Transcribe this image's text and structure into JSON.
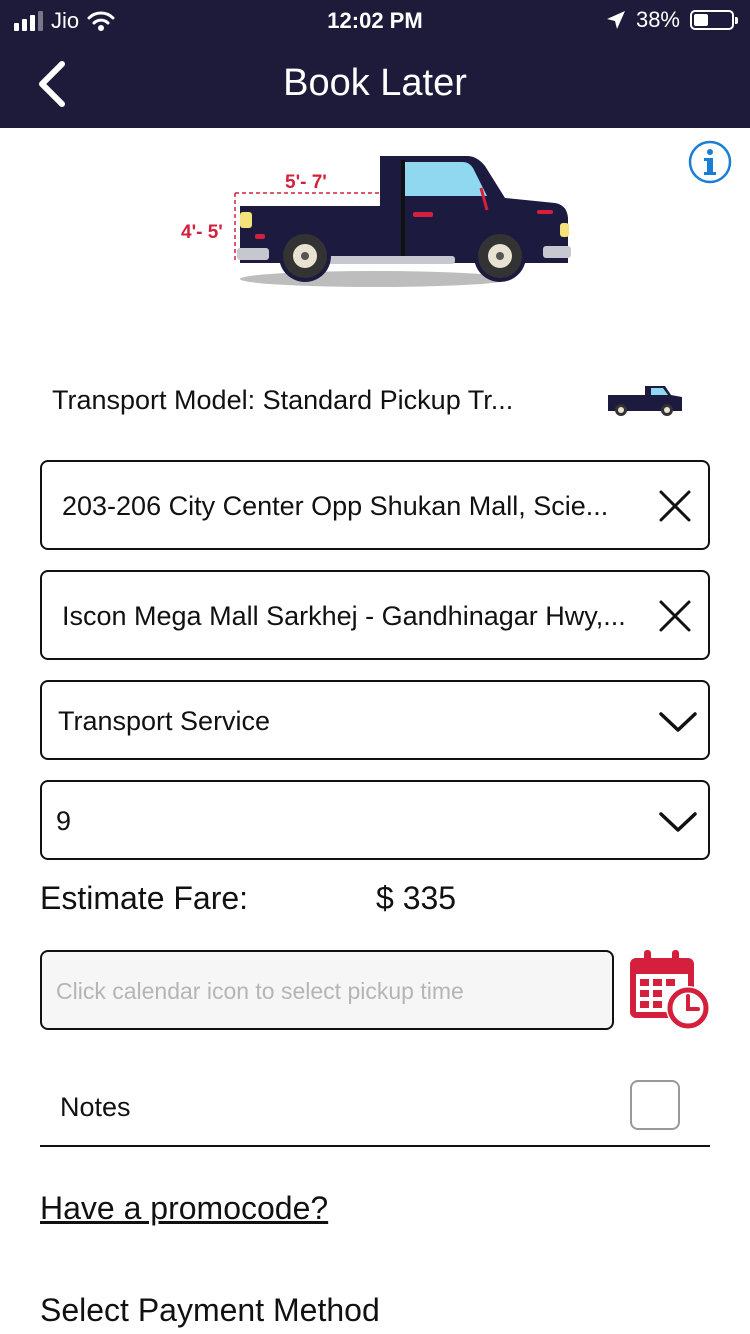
{
  "status_bar": {
    "carrier": "Jio",
    "time": "12:02 PM",
    "battery": "38%",
    "battery_level": 0.38
  },
  "header": {
    "title": "Book Later"
  },
  "transport_model": {
    "label": "Transport Model: Standard Pickup Tr..."
  },
  "truck_dimensions": {
    "length": "5'- 7'",
    "height": "4'- 5'"
  },
  "pickup_address": {
    "value": "203-206 City Center Opp Shukan Mall, Scie..."
  },
  "dropoff_address": {
    "value": "Iscon Mega Mall Sarkhej - Gandhinagar Hwy,..."
  },
  "service_select": {
    "value": "Transport Service"
  },
  "quantity_select": {
    "value": "9"
  },
  "fare": {
    "label": "Estimate Fare:",
    "value": "$ 335"
  },
  "pickup_time": {
    "placeholder": "Click calendar icon to select pickup time"
  },
  "notes": {
    "label": "Notes"
  },
  "promo": {
    "label": "Have a promocode?"
  },
  "payment": {
    "label": "Select Payment Method"
  },
  "colors": {
    "header_bg": "#1e1b3a",
    "accent_red": "#d4203c",
    "info_blue": "#1a7fd4"
  }
}
